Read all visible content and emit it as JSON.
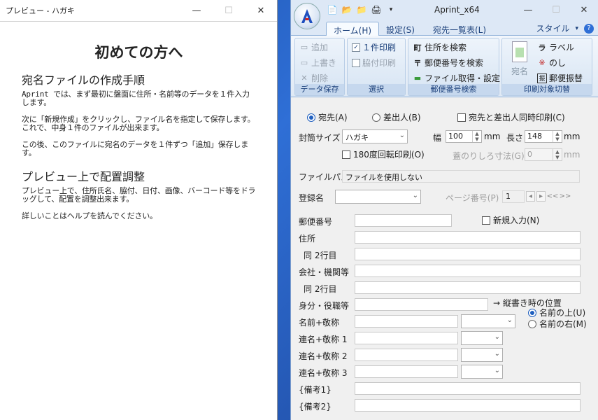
{
  "preview": {
    "title": "プレビュー - ハガキ",
    "heading": "初めての方へ",
    "section1_title": "宛名ファイルの作成手順",
    "p1": "Aprint では、まず最初に盤面に住所・名前等のデータを１件入力します。",
    "p2": "次に「新規作成」をクリックし、ファイル名を指定して保存します。これで、中身１件のファイルが出来ます。",
    "p3": "この後、このファイルに宛名のデータを１件ずつ「追加」保存します。",
    "section2_title": "プレビュー上で配置調整",
    "p4": "プレビュー上で、住所氏名、脇付、日付、画像、バーコード等をドラッグして、配置を調整出来ます。",
    "p5": "詳しいことはヘルプを読んでください。"
  },
  "app": {
    "title": "Aprint_x64",
    "tabs": [
      "ホーム(H)",
      "設定(S)",
      "宛先一覧表(L)"
    ],
    "style_label": "スタイル",
    "groups": {
      "data_save": {
        "label": "データ保存",
        "add": "追加",
        "overwrite": "上書き",
        "delete": "削除"
      },
      "select": {
        "label": "選択",
        "print_one": "１件印刷",
        "side_print": "脇付印刷"
      },
      "postal": {
        "label": "郵便番号検索",
        "addr_search": "住所を検索",
        "zip_search": "郵便番号を検索",
        "file_setting": "ファイル取得・設定"
      },
      "target": {
        "label": "印刷対象切替",
        "atena": "宛名",
        "label_btn": "ラベル",
        "noshi": "のし",
        "transfer": "郵便振替"
      }
    },
    "form": {
      "radio_dest": "宛先(A)",
      "radio_sender": "差出人(B)",
      "chk_both": "宛先と差出人同時印刷(C)",
      "envelope_label": "封筒サイズ",
      "envelope_value": "ハガキ",
      "width_label": "幅",
      "width_value": "100",
      "height_label": "長さ",
      "height_value": "148",
      "unit": "mm",
      "rotate": "180度回転印刷(O)",
      "flap_label": "蓋のりしろ寸法(G)",
      "flap_value": "0",
      "filepath_label": "ファイルパス",
      "filepath_value": "ファイルを使用しない",
      "regname_label": "登録名",
      "page_label": "ページ番号(P)",
      "page_value": "1",
      "page_nav": [
        "◂",
        "▸",
        "<<",
        ">>"
      ],
      "zip_label": "郵便番号",
      "new_input": "新規入力(N)",
      "address": "住所",
      "address2": "同 2行目",
      "company": "会社・機関等",
      "company2": "同 2行目",
      "position": "身分・役職等",
      "vertical_pos": "→ 縦書き時の位置",
      "name_above": "名前の上(U)",
      "name_right": "名前の右(M)",
      "name": "名前+敬称",
      "joint1": "連名+敬称 1",
      "joint2": "連名+敬称 2",
      "joint3": "連名+敬称 3",
      "note1": "{備考1}",
      "note2": "{備考2}"
    }
  }
}
